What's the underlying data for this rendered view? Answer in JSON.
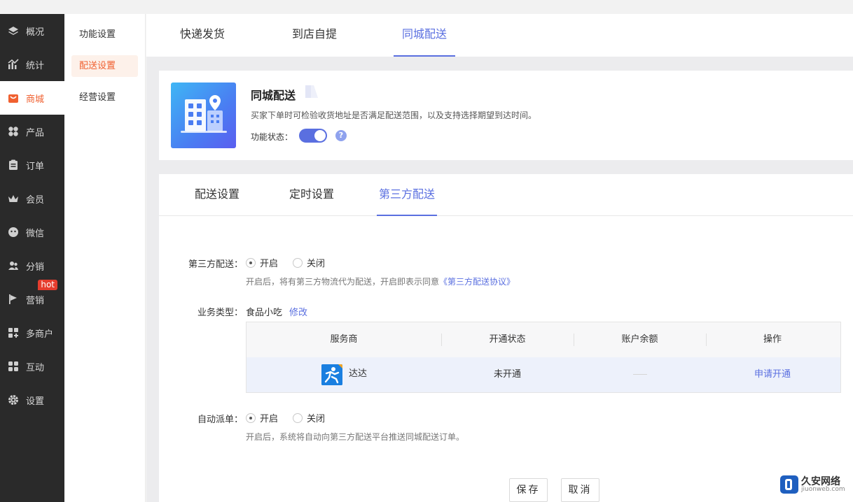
{
  "sidebar": {
    "items": [
      {
        "label": "概况",
        "icon": "layers-icon"
      },
      {
        "label": "统计",
        "icon": "chart-icon"
      },
      {
        "label": "商城",
        "icon": "store-icon",
        "active": true
      },
      {
        "label": "产品",
        "icon": "grid-icon"
      },
      {
        "label": "订单",
        "icon": "order-icon"
      },
      {
        "label": "会员",
        "icon": "crown-icon"
      },
      {
        "label": "微信",
        "icon": "wechat-icon"
      },
      {
        "label": "分销",
        "icon": "users-icon"
      },
      {
        "label": "营销",
        "icon": "flag-icon",
        "badge": "hot"
      },
      {
        "label": "多商户",
        "icon": "merchant-icon"
      },
      {
        "label": "互动",
        "icon": "interact-icon"
      },
      {
        "label": "设置",
        "icon": "gear-icon"
      }
    ]
  },
  "subnav": {
    "items": [
      "功能设置",
      "配送设置",
      "经营设置"
    ],
    "active": "配送设置"
  },
  "delivery_tabs": {
    "items": [
      "快递发货",
      "到店自提",
      "同城配送"
    ],
    "active": "同城配送"
  },
  "feature": {
    "title": "同城配送",
    "description": "买家下单时可检验收货地址是否满足配送范围，以及支持选择期望到达时间。",
    "status_label": "功能状态：",
    "status_on": true,
    "help": "?"
  },
  "settings_tabs": {
    "items": [
      "配送设置",
      "定时设置",
      "第三方配送"
    ],
    "active": "第三方配送"
  },
  "form": {
    "third_party": {
      "label": "第三方配送：",
      "options": [
        "开启",
        "关闭"
      ],
      "selected": "开启",
      "hint_prefix": "开启后，将有第三方物流代为配送，开启即表示同意",
      "hint_link": "《第三方配送协议》"
    },
    "business_type": {
      "label": "业务类型：",
      "value": "食品小吃",
      "edit": "修改"
    },
    "providers_table": {
      "headers": [
        "服务商",
        "开通状态",
        "账户余额",
        "操作"
      ],
      "rows": [
        {
          "name": "达达",
          "status": "未开通",
          "balance": "",
          "action": "申请开通"
        }
      ]
    },
    "auto_dispatch": {
      "label": "自动派单：",
      "options": [
        "开启",
        "关闭"
      ],
      "selected": "开启",
      "hint": "开启后，系统将自动向第三方配送平台推送同城配送订单。"
    }
  },
  "buttons": {
    "save": "保存",
    "cancel": "取消"
  },
  "watermark": {
    "title": "久安网络",
    "sub": "jiuonweb.com"
  },
  "colors": {
    "accent": "#5a6fe0",
    "brand_orange": "#f06030",
    "sidebar_bg": "#2a2a2a"
  }
}
